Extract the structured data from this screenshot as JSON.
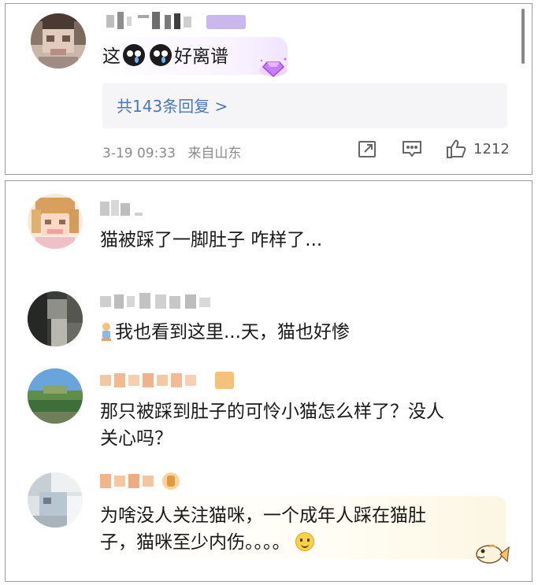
{
  "top_comment": {
    "text_prefix": "这",
    "text_suffix": "好离谱",
    "replies_label": "共143条回复 >",
    "date": "3-19 09:33",
    "location": "来自山东",
    "like_count": "1212",
    "icons": [
      "share-icon",
      "comment-icon",
      "like-icon"
    ]
  },
  "replies": [
    {
      "text": "猫被踩了一脚肚子 咋样了..."
    },
    {
      "text": "我也看到这里...天，猫也好惨"
    },
    {
      "text_line1": "那只被踩到肚子的可怜小猫怎么样了？没人",
      "text_line2": "关心吗？"
    },
    {
      "text_line1": "为啥没人关注猫咪，一个成年人踩在猫肚",
      "text_line2": "子，猫咪至少内伤。。。。"
    }
  ],
  "colors": {
    "link": "#4a78b5",
    "meta": "#8b8b8b",
    "reply_box": "#f5f5f7"
  }
}
